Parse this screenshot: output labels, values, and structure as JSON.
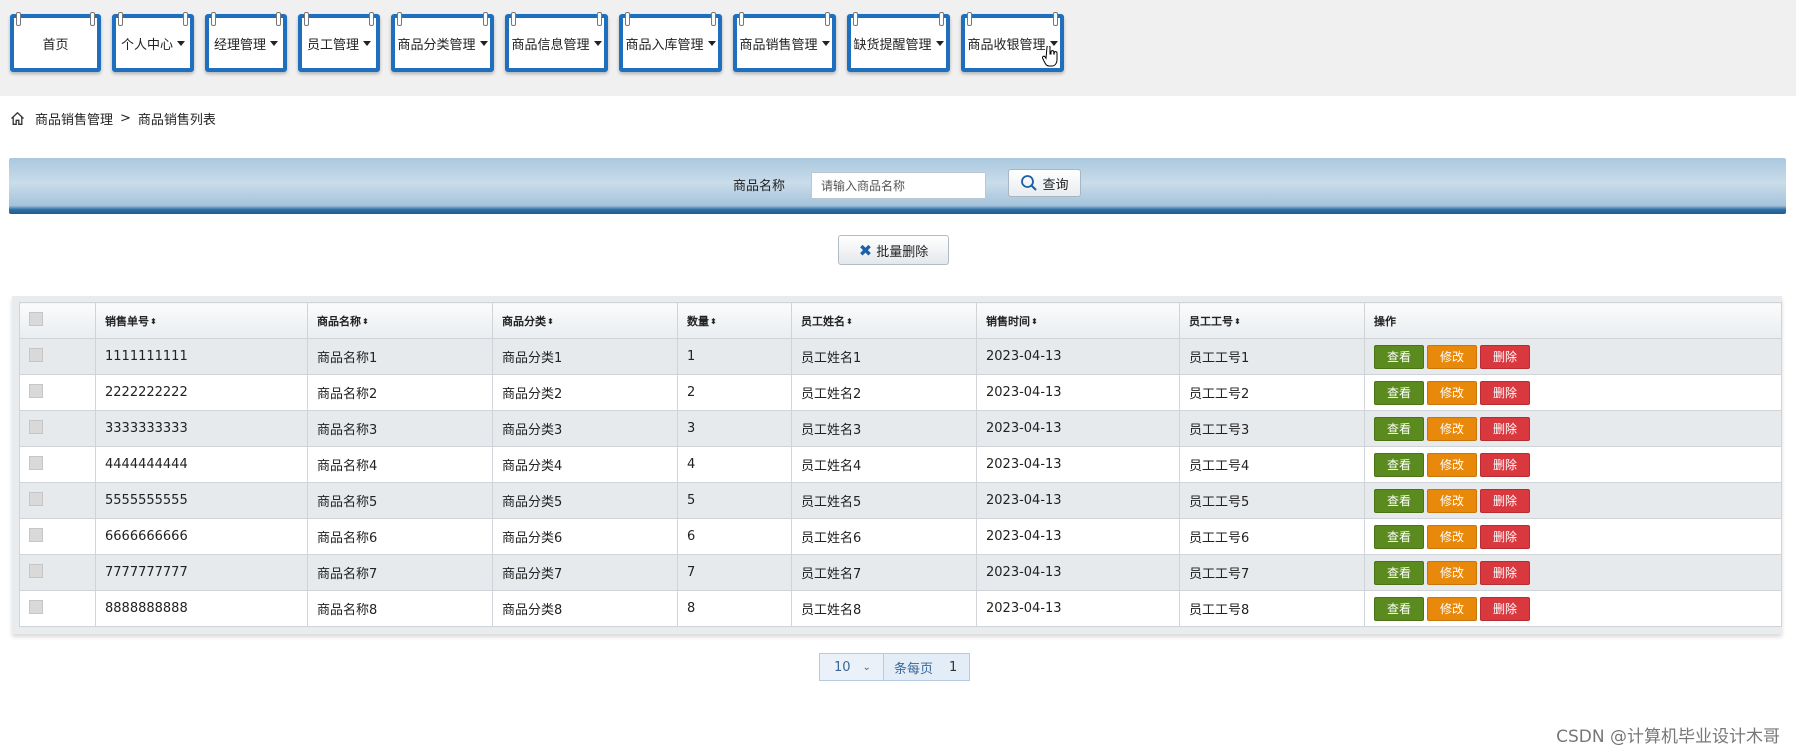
{
  "nav": {
    "items": [
      {
        "label": "首页",
        "caret": false
      },
      {
        "label": "个人中心",
        "caret": true
      },
      {
        "label": "经理管理",
        "caret": true
      },
      {
        "label": "员工管理",
        "caret": true
      },
      {
        "label": "商品分类管理",
        "caret": true
      },
      {
        "label": "商品信息管理",
        "caret": true
      },
      {
        "label": "商品入库管理",
        "caret": true
      },
      {
        "label": "商品销售管理",
        "caret": true
      },
      {
        "label": "缺货提醒管理",
        "caret": true
      },
      {
        "label": "商品收银管理",
        "caret": true
      }
    ]
  },
  "breadcrumb": {
    "section": "商品销售管理",
    "separator": ">",
    "page": "商品销售列表"
  },
  "search": {
    "label": "商品名称",
    "placeholder": "请输入商品名称",
    "button_label": "查询"
  },
  "batch_delete_label": "批量删除",
  "table": {
    "headers": [
      "销售单号",
      "商品名称",
      "商品分类",
      "数量",
      "员工姓名",
      "销售时间",
      "员工工号",
      "操作"
    ],
    "sortable": [
      true,
      true,
      true,
      true,
      true,
      true,
      true,
      false
    ],
    "rows": [
      [
        "1111111111",
        "商品名称1",
        "商品分类1",
        "1",
        "员工姓名1",
        "2023-04-13",
        "员工工号1"
      ],
      [
        "2222222222",
        "商品名称2",
        "商品分类2",
        "2",
        "员工姓名2",
        "2023-04-13",
        "员工工号2"
      ],
      [
        "3333333333",
        "商品名称3",
        "商品分类3",
        "3",
        "员工姓名3",
        "2023-04-13",
        "员工工号3"
      ],
      [
        "4444444444",
        "商品名称4",
        "商品分类4",
        "4",
        "员工姓名4",
        "2023-04-13",
        "员工工号4"
      ],
      [
        "5555555555",
        "商品名称5",
        "商品分类5",
        "5",
        "员工姓名5",
        "2023-04-13",
        "员工工号5"
      ],
      [
        "6666666666",
        "商品名称6",
        "商品分类6",
        "6",
        "员工姓名6",
        "2023-04-13",
        "员工工号6"
      ],
      [
        "7777777777",
        "商品名称7",
        "商品分类7",
        "7",
        "员工姓名7",
        "2023-04-13",
        "员工工号7"
      ],
      [
        "8888888888",
        "商品名称8",
        "商品分类8",
        "8",
        "员工姓名8",
        "2023-04-13",
        "员工工号8"
      ]
    ],
    "actions": {
      "view": "查看",
      "edit": "修改",
      "delete": "删除"
    }
  },
  "pager": {
    "page_size": "10",
    "per_page_label": "条每页",
    "current_page": "1"
  },
  "watermark": "CSDN @计算机毕业设计木哥",
  "colors": {
    "nav_border": "#1f6fbf",
    "view_button": "#5b8a1f",
    "edit_button": "#e8890c",
    "delete_button": "#d9383f"
  }
}
